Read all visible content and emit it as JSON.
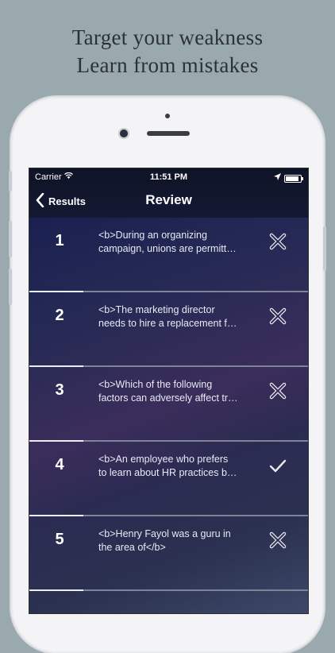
{
  "headline": {
    "line1": "Target your weakness",
    "line2": "Learn from mistakes"
  },
  "status_bar": {
    "carrier": "Carrier",
    "time": "11:51 PM"
  },
  "nav": {
    "back_label": "Results",
    "title": "Review"
  },
  "rows": [
    {
      "number": "1",
      "line1": "<b>During an organizing",
      "line2": "campaign, unions are permitt…",
      "status": "incorrect"
    },
    {
      "number": "2",
      "line1": "<b>The marketing director",
      "line2": "needs to hire a replacement f…",
      "status": "incorrect"
    },
    {
      "number": "3",
      "line1": "<b>Which of the following",
      "line2": "factors can adversely affect tr…",
      "status": "incorrect"
    },
    {
      "number": "4",
      "line1": "<b>An employee who prefers",
      "line2": "to learn about HR practices b…",
      "status": "correct"
    },
    {
      "number": "5",
      "line1": "<b>Henry Fayol was a guru in",
      "line2": "the area of</b>",
      "status": "incorrect"
    }
  ],
  "colors": {
    "background": "#9aa9ad",
    "navbar": "#141933",
    "list_top": "#1a2050",
    "list_mid": "#3b2d5b"
  }
}
